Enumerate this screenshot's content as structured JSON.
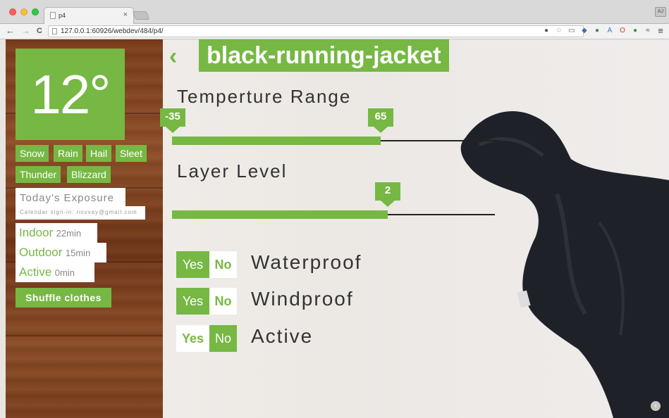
{
  "browser": {
    "tab_title": "p4",
    "tab_close": "×",
    "user_badge": "AJ",
    "url": "127.0.0.1:60926/webdev/484/p4/",
    "back": "←",
    "forward": "→",
    "reload": "C",
    "menu": "≡"
  },
  "weather": {
    "temperature": "12°",
    "conditions": [
      "Snow",
      "Rain",
      "Hail",
      "Sleet",
      "Thunder",
      "Blizzard"
    ]
  },
  "exposure": {
    "title": "Today's Exposure",
    "calendar": "Calendar sign-in: novvay@gmail.com",
    "rows": [
      {
        "label": "Indoor",
        "value": "22min"
      },
      {
        "label": "Outdoor",
        "value": "15min"
      },
      {
        "label": "Active",
        "value": "0min"
      }
    ],
    "shuffle": "Shuffle clothes"
  },
  "item": {
    "back_icon": "‹",
    "title": "black-running-jacket",
    "temp_range": {
      "label": "Temperture Range",
      "min": "-35",
      "max": "65"
    },
    "layer": {
      "label": "Layer Level",
      "value": "2"
    },
    "toggles": [
      {
        "label": "Waterproof",
        "yes": "Yes",
        "no": "No",
        "selected": "Yes"
      },
      {
        "label": "Windproof",
        "yes": "Yes",
        "no": "No",
        "selected": "Yes"
      },
      {
        "label": "Active",
        "yes": "Yes",
        "no": "No",
        "selected": "No"
      }
    ]
  },
  "colors": {
    "accent": "#76b843",
    "wood": "#7a3d1c"
  }
}
